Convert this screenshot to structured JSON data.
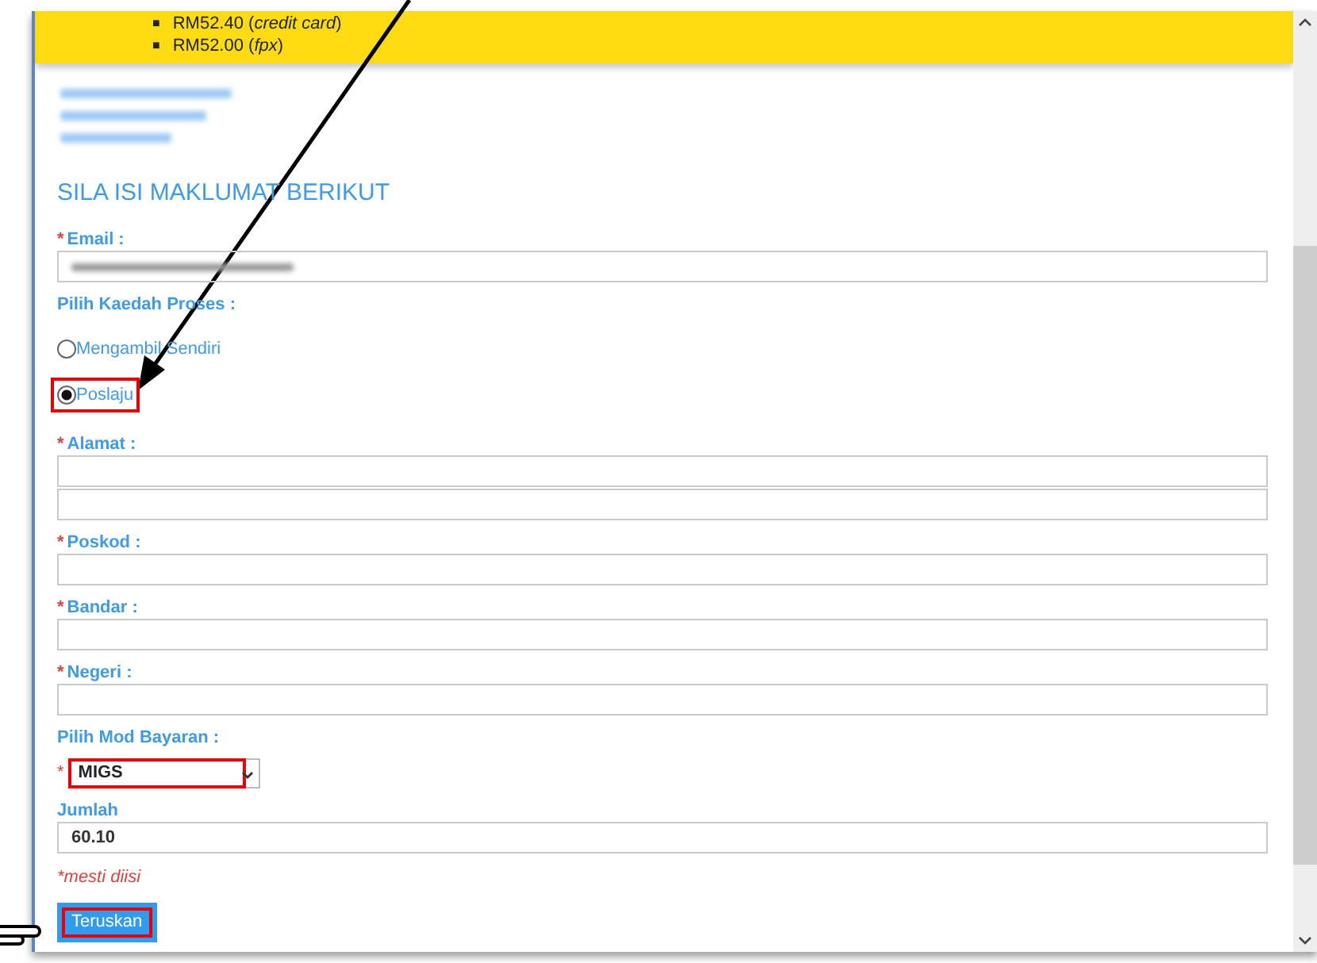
{
  "banner": {
    "items": [
      {
        "marker": "■",
        "text": "RM52.40 (*credit card*)"
      },
      {
        "marker": "■",
        "text": "RM52.00 (*fpx*)"
      }
    ]
  },
  "form": {
    "title": "SILA ISI MAKLUMAT BERIKUT",
    "sections": [
      {
        "kind": "input",
        "label": "Email :",
        "required_mark": "*",
        "fields": [
          {
            "kind": "blurred"
          }
        ]
      },
      {
        "kind": "radio",
        "label": "Pilih Kaedah Proses :",
        "options": [
          {
            "label": "Mengambil Sendiri",
            "selected": false,
            "highlighted": false
          },
          {
            "label": "Poslaju",
            "selected": true,
            "highlighted": true
          }
        ]
      },
      {
        "kind": "input",
        "label": "Alamat :",
        "required_mark": "*",
        "fields": [
          {
            "kind": "empty"
          },
          {
            "kind": "empty"
          }
        ]
      },
      {
        "kind": "input",
        "label": "Poskod :",
        "required_mark": "*",
        "fields": [
          {
            "kind": "empty"
          }
        ]
      },
      {
        "kind": "input",
        "label": "Bandar :",
        "required_mark": "*",
        "fields": [
          {
            "kind": "empty"
          }
        ]
      },
      {
        "kind": "input",
        "label": "Negeri :",
        "required_mark": "*",
        "fields": [
          {
            "kind": "empty"
          }
        ]
      },
      {
        "kind": "select",
        "label": "Pilih Mod Bayaran :",
        "required_mark": "*",
        "value": "MIGS",
        "highlighted": true
      },
      {
        "kind": "input",
        "label": "Jumlah",
        "fields": [
          {
            "kind": "filled",
            "value": "60.10"
          }
        ]
      }
    ],
    "note": "*mesti diisi",
    "submit": {
      "label": "Teruskan",
      "highlighted": true
    }
  }
}
